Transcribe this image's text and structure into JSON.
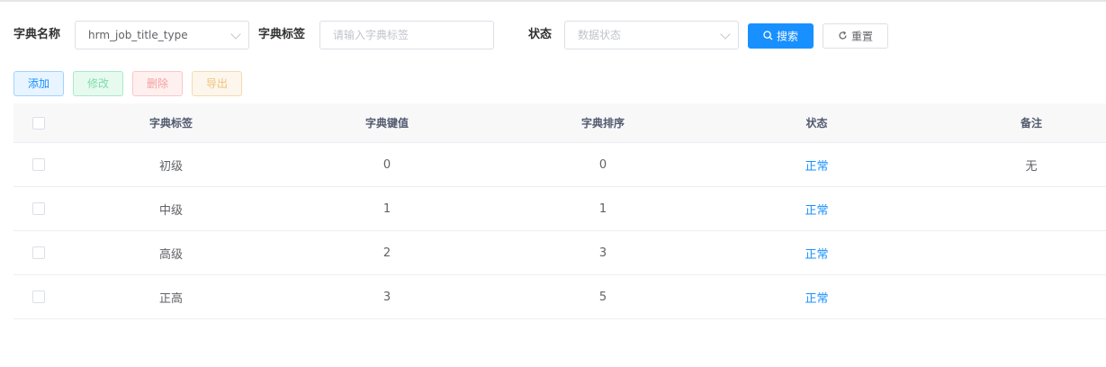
{
  "search": {
    "dict_name_label": "字典名称",
    "dict_name_value": "hrm_job_title_type",
    "dict_label_label": "字典标签",
    "dict_label_placeholder": "请输入字典标签",
    "status_label": "状态",
    "status_placeholder": "数据状态",
    "search_button": "搜索",
    "reset_button": "重置"
  },
  "toolbar": {
    "add": "添加",
    "edit": "修改",
    "delete": "删除",
    "export": "导出"
  },
  "table": {
    "headers": {
      "label": "字典标签",
      "key": "字典键值",
      "sort": "字典排序",
      "status": "状态",
      "remark": "备注"
    },
    "rows": [
      {
        "label": "初级",
        "key": "0",
        "sort": "0",
        "status": "正常",
        "remark": "无"
      },
      {
        "label": "中级",
        "key": "1",
        "sort": "1",
        "status": "正常",
        "remark": ""
      },
      {
        "label": "高级",
        "key": "2",
        "sort": "3",
        "status": "正常",
        "remark": ""
      },
      {
        "label": "正高",
        "key": "3",
        "sort": "5",
        "status": "正常",
        "remark": ""
      }
    ]
  },
  "colors": {
    "primary": "#1890ff",
    "success": "#13ce66",
    "danger": "#ff4949",
    "warning": "#ffba00"
  }
}
